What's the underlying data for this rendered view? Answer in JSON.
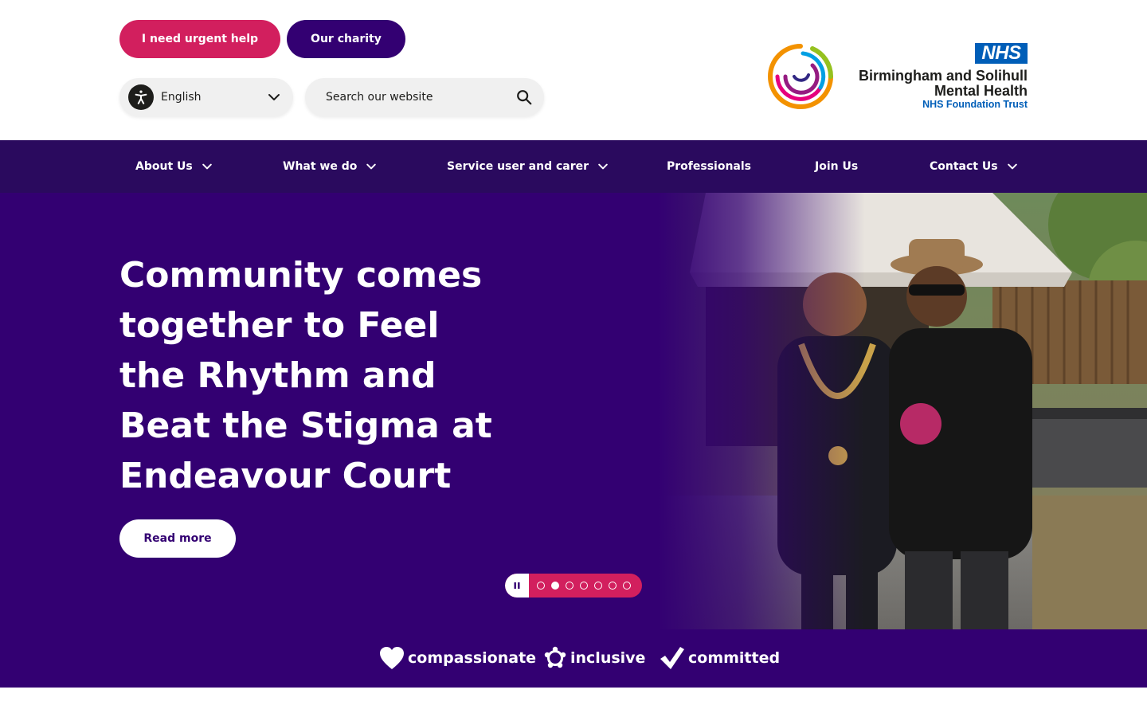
{
  "header": {
    "urgent_help_label": "I need urgent help",
    "charity_label": "Our charity",
    "language": "English",
    "search_placeholder": "Search our website",
    "logo": {
      "nhs": "NHS",
      "trust_line1": "Birmingham and Solihull",
      "trust_line2": "Mental Health",
      "trust_sub": "NHS Foundation Trust"
    }
  },
  "nav": {
    "items": [
      {
        "label": "About Us",
        "has_dropdown": true
      },
      {
        "label": "What we do",
        "has_dropdown": true
      },
      {
        "label": "Service user and carer",
        "has_dropdown": true
      },
      {
        "label": "Professionals",
        "has_dropdown": false
      },
      {
        "label": "Join Us",
        "has_dropdown": false
      },
      {
        "label": "Contact Us",
        "has_dropdown": true
      }
    ]
  },
  "hero": {
    "title": "Community comes together to Feel the Rhythm and Beat the Stigma at Endeavour Court",
    "cta_label": "Read more",
    "slides_total": 7,
    "active_slide": 2
  },
  "values": {
    "items": [
      {
        "label": "compassionate",
        "icon": "heart-icon"
      },
      {
        "label": "inclusive",
        "icon": "people-circle-icon"
      },
      {
        "label": "committed",
        "icon": "tick-icon"
      }
    ]
  },
  "colors": {
    "brand_purple": "#330072",
    "nav_purple": "#2a0a5e",
    "brand_pink": "#d21f5e",
    "nhs_blue": "#005eb8"
  }
}
